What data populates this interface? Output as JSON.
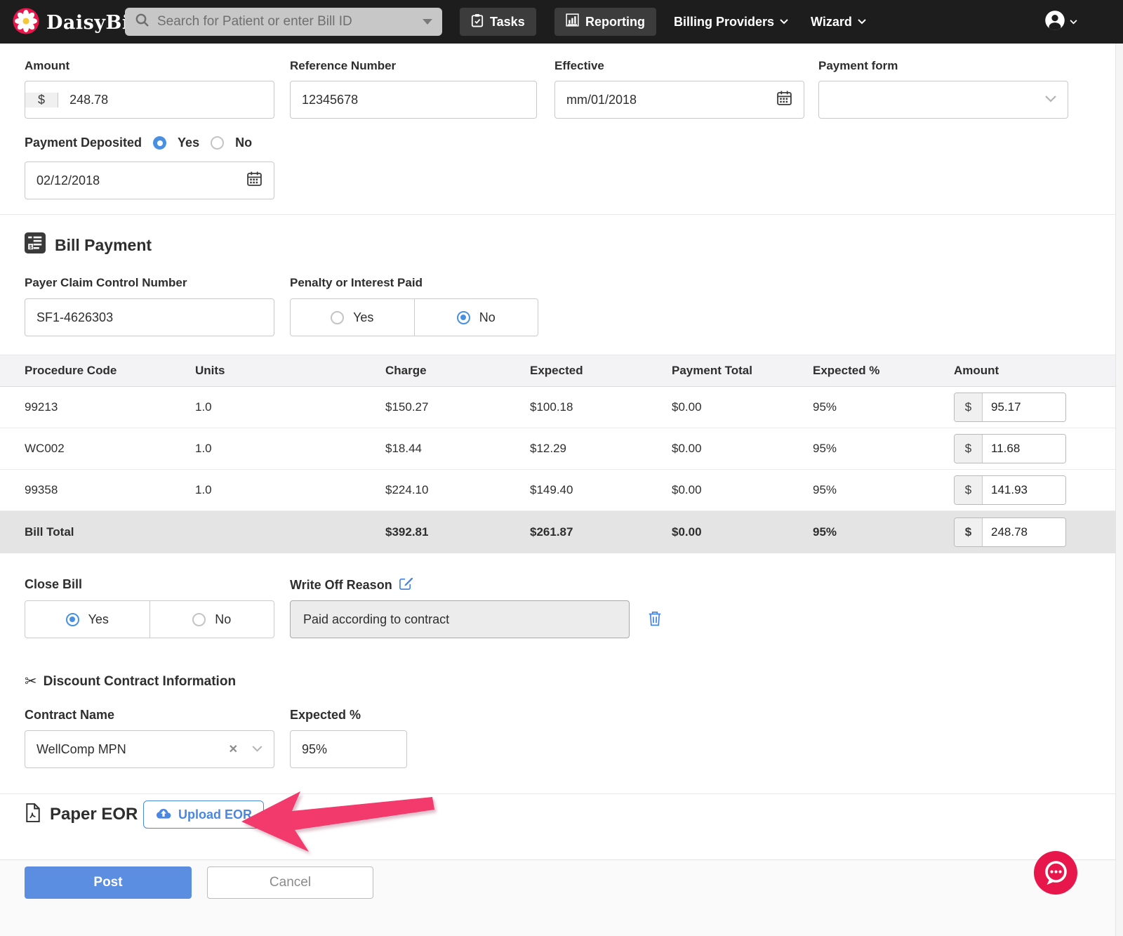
{
  "colors": {
    "navbar_bg": "#1d1d1d",
    "brand_crimson": "#e8174b",
    "accent_blue": "#4a87e0",
    "radio_blue": "#4a90e2",
    "post_button_blue": "#5b8de0",
    "arrow_pink": "#f23a6d",
    "table_header_bg": "#f3f3f5",
    "total_row_bg": "#e4e4e4"
  },
  "navbar": {
    "brand": "DaisyBill",
    "search_placeholder": "Search for Patient or enter Bill ID",
    "tasks": "Tasks",
    "reporting": "Reporting",
    "billing_providers": "Billing Providers",
    "wizard": "Wizard"
  },
  "top_form": {
    "amount_label": "Amount",
    "currency": "$",
    "amount_value": "248.78",
    "reference_label": "Reference Number",
    "reference_value": "12345678",
    "effective_label": "Effective",
    "effective_value": "mm/01/2018",
    "payment_form_label": "Payment form",
    "payment_form_value": "",
    "deposited_label": "Payment Deposited",
    "yes": "Yes",
    "no": "No",
    "deposited_selected": "Yes",
    "deposit_date": "02/12/2018"
  },
  "bill_payment": {
    "title": "Bill Payment",
    "payer_claim_label": "Payer Claim Control Number",
    "payer_claim_value": "SF1-4626303",
    "penalty_label": "Penalty or Interest Paid",
    "yes": "Yes",
    "no": "No",
    "penalty_selected": "No"
  },
  "table": {
    "headers": [
      "Procedure Code",
      "Units",
      "Charge",
      "Expected",
      "Payment Total",
      "Expected %",
      "Amount"
    ],
    "currency": "$",
    "rows": [
      {
        "code": "99213",
        "units": "1.0",
        "charge": "$150.27",
        "expected": "$100.18",
        "payment_total": "$0.00",
        "expected_pct": "95%",
        "amount": "95.17"
      },
      {
        "code": "WC002",
        "units": "1.0",
        "charge": "$18.44",
        "expected": "$12.29",
        "payment_total": "$0.00",
        "expected_pct": "95%",
        "amount": "11.68"
      },
      {
        "code": "99358",
        "units": "1.0",
        "charge": "$224.10",
        "expected": "$149.40",
        "payment_total": "$0.00",
        "expected_pct": "95%",
        "amount": "141.93"
      }
    ],
    "total": {
      "label": "Bill Total",
      "charge": "$392.81",
      "expected": "$261.87",
      "payment_total": "$0.00",
      "expected_pct": "95%",
      "amount": "248.78"
    }
  },
  "close_section": {
    "close_label": "Close Bill",
    "yes": "Yes",
    "no": "No",
    "close_selected": "Yes",
    "write_off_label": "Write Off Reason",
    "write_off_value": "Paid according to contract"
  },
  "discount": {
    "title": "Discount Contract Information",
    "contract_label": "Contract Name",
    "contract_value": "WellComp MPN",
    "expected_label": "Expected %",
    "expected_value": "95%"
  },
  "paper_eor": {
    "title": "Paper EOR",
    "upload": "Upload EOR"
  },
  "footer": {
    "post": "Post",
    "cancel": "Cancel"
  }
}
